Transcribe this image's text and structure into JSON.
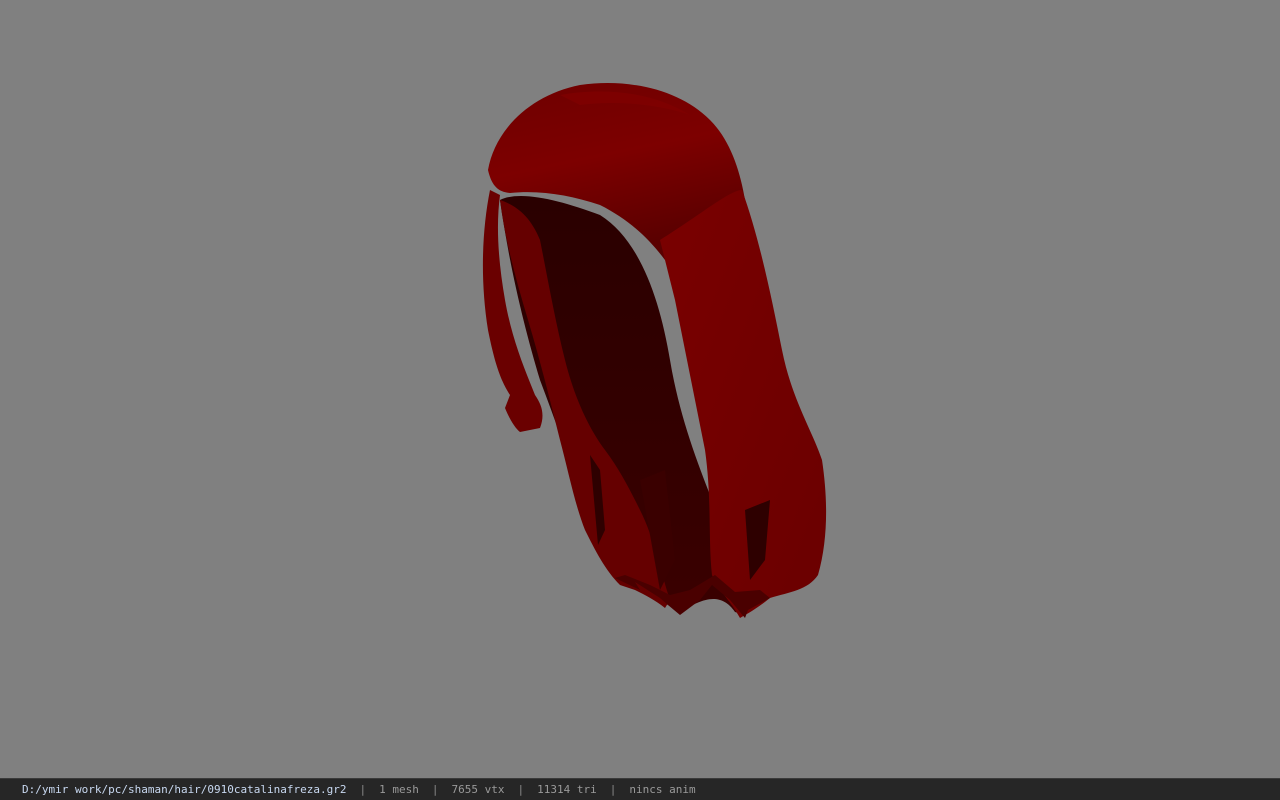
{
  "viewport": {
    "model": "hair-mesh",
    "background_color": "#808080",
    "model_color": "#7a0000"
  },
  "status": {
    "file_path": "D:/ymir work/pc/shaman/hair/0910catalinafreza.gr2",
    "separator": "|",
    "mesh_count": "1 mesh",
    "vertex_count": "7655 vtx",
    "triangle_count": "11314 tri",
    "anim": "nincs anim"
  }
}
